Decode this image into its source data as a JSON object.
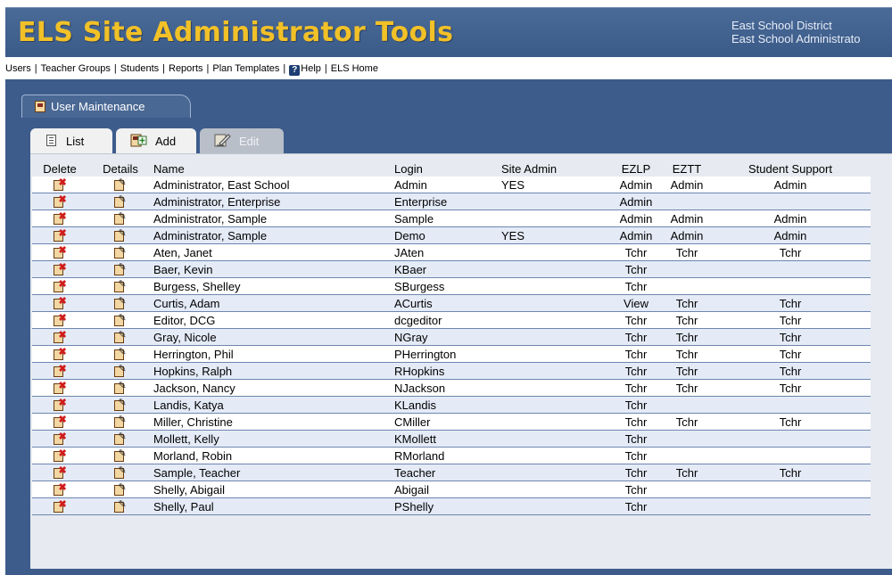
{
  "app": {
    "title": "ELS Site Administrator Tools",
    "district_line1": "East School District",
    "district_line2": "East School Administrato"
  },
  "nav": {
    "items": [
      "Users",
      "Teacher Groups",
      "Students",
      "Reports",
      "Plan Templates",
      "Help",
      "ELS Home"
    ]
  },
  "section_tab": {
    "label": "User Maintenance"
  },
  "subtabs": {
    "list": "List",
    "add": "Add",
    "edit": "Edit"
  },
  "table": {
    "headers": [
      "Delete",
      "Details",
      "Name",
      "Login",
      "Site Admin",
      "EZLP",
      "EZTT",
      "Student Support"
    ],
    "rows": [
      {
        "name": "Administrator, East School",
        "login": "Admin",
        "site_admin": "YES",
        "ezlp": "Admin",
        "eztt": "Admin",
        "support": "Admin"
      },
      {
        "name": "Administrator, Enterprise",
        "login": "Enterprise",
        "site_admin": "",
        "ezlp": "Admin",
        "eztt": "",
        "support": ""
      },
      {
        "name": "Administrator, Sample",
        "login": "Sample",
        "site_admin": "",
        "ezlp": "Admin",
        "eztt": "Admin",
        "support": "Admin"
      },
      {
        "name": "Administrator, Sample",
        "login": "Demo",
        "site_admin": "YES",
        "ezlp": "Admin",
        "eztt": "Admin",
        "support": "Admin"
      },
      {
        "name": "Aten, Janet",
        "login": "JAten",
        "site_admin": "",
        "ezlp": "Tchr",
        "eztt": "Tchr",
        "support": "Tchr"
      },
      {
        "name": "Baer, Kevin",
        "login": "KBaer",
        "site_admin": "",
        "ezlp": "Tchr",
        "eztt": "",
        "support": ""
      },
      {
        "name": "Burgess, Shelley",
        "login": "SBurgess",
        "site_admin": "",
        "ezlp": "Tchr",
        "eztt": "",
        "support": ""
      },
      {
        "name": "Curtis, Adam",
        "login": "ACurtis",
        "site_admin": "",
        "ezlp": "View",
        "eztt": "Tchr",
        "support": "Tchr"
      },
      {
        "name": "Editor, DCG",
        "login": "dcgeditor",
        "site_admin": "",
        "ezlp": "Tchr",
        "eztt": "Tchr",
        "support": "Tchr"
      },
      {
        "name": "Gray, Nicole",
        "login": "NGray",
        "site_admin": "",
        "ezlp": "Tchr",
        "eztt": "Tchr",
        "support": "Tchr"
      },
      {
        "name": "Herrington, Phil",
        "login": "PHerrington",
        "site_admin": "",
        "ezlp": "Tchr",
        "eztt": "Tchr",
        "support": "Tchr"
      },
      {
        "name": "Hopkins, Ralph",
        "login": "RHopkins",
        "site_admin": "",
        "ezlp": "Tchr",
        "eztt": "Tchr",
        "support": "Tchr"
      },
      {
        "name": "Jackson, Nancy",
        "login": "NJackson",
        "site_admin": "",
        "ezlp": "Tchr",
        "eztt": "Tchr",
        "support": "Tchr"
      },
      {
        "name": "Landis, Katya",
        "login": "KLandis",
        "site_admin": "",
        "ezlp": "Tchr",
        "eztt": "",
        "support": ""
      },
      {
        "name": "Miller, Christine",
        "login": "CMiller",
        "site_admin": "",
        "ezlp": "Tchr",
        "eztt": "Tchr",
        "support": "Tchr"
      },
      {
        "name": "Mollett, Kelly",
        "login": "KMollett",
        "site_admin": "",
        "ezlp": "Tchr",
        "eztt": "",
        "support": ""
      },
      {
        "name": "Morland, Robin",
        "login": "RMorland",
        "site_admin": "",
        "ezlp": "Tchr",
        "eztt": "",
        "support": ""
      },
      {
        "name": "Sample, Teacher",
        "login": "Teacher",
        "site_admin": "",
        "ezlp": "Tchr",
        "eztt": "Tchr",
        "support": "Tchr"
      },
      {
        "name": "Shelly, Abigail",
        "login": "Abigail",
        "site_admin": "",
        "ezlp": "Tchr",
        "eztt": "",
        "support": ""
      },
      {
        "name": "Shelly, Paul",
        "login": "PShelly",
        "site_admin": "",
        "ezlp": "Tchr",
        "eztt": "",
        "support": ""
      }
    ]
  },
  "icons": {
    "delete": "delete-user-icon",
    "details": "edit-details-icon",
    "help": "help-icon",
    "section": "user-maintenance-icon"
  },
  "colors": {
    "header_bg": "#3d5c8c",
    "title": "#f2c128",
    "row_alt": "#e4ebf7"
  }
}
